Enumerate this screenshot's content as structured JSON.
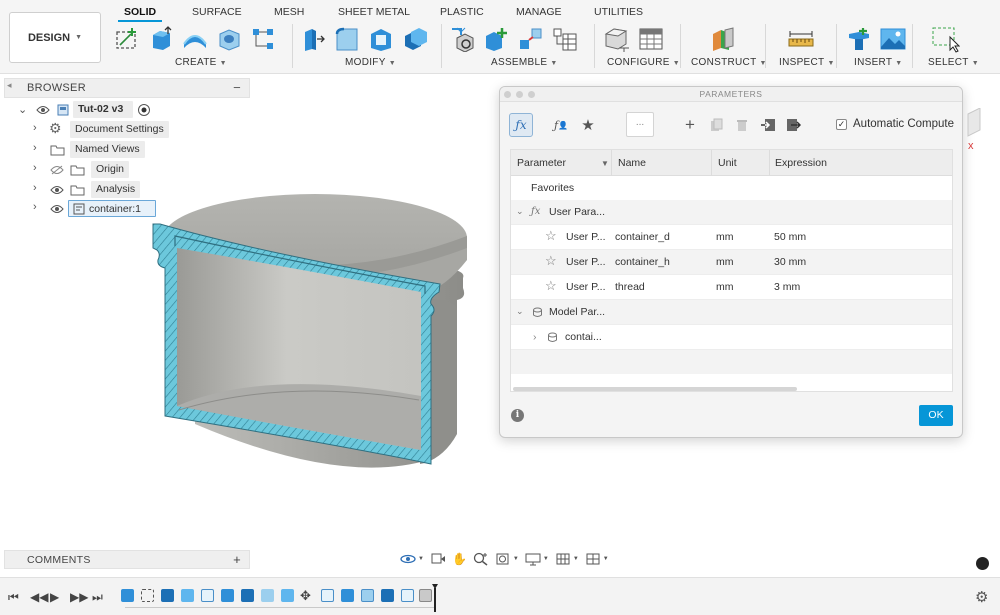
{
  "workspace": {
    "label": "DESIGN"
  },
  "tabs": [
    "SOLID",
    "SURFACE",
    "MESH",
    "SHEET METAL",
    "PLASTIC",
    "MANAGE",
    "UTILITIES"
  ],
  "groups": {
    "create": "CREATE",
    "modify": "MODIFY",
    "assemble": "ASSEMBLE",
    "configure": "CONFIGURE",
    "construct": "CONSTRUCT",
    "inspect": "INSPECT",
    "insert": "INSERT",
    "select": "SELECT"
  },
  "browser": {
    "title": "BROWSER",
    "root": "Tut-02 v3",
    "items": [
      "Document Settings",
      "Named Views",
      "Origin",
      "Analysis",
      "container:1"
    ]
  },
  "comments": {
    "title": "COMMENTS"
  },
  "dialog": {
    "title": "PARAMETERS",
    "filter_value": "...",
    "auto_compute_label": "Automatic Compute",
    "columns": [
      "Parameter",
      "Name",
      "Unit",
      "Expression"
    ],
    "favorites_label": "Favorites",
    "user_group": "User Para...",
    "user_params": [
      {
        "type": "User P...",
        "name": "container_d",
        "unit": "mm",
        "expression": "50 mm"
      },
      {
        "type": "User P...",
        "name": "container_h",
        "unit": "mm",
        "expression": "30 mm"
      },
      {
        "type": "User P...",
        "name": "thread",
        "unit": "mm",
        "expression": "3 mm"
      }
    ],
    "model_group": "Model Par...",
    "model_item": "contai...",
    "ok_label": "OK"
  },
  "colors": {
    "accent": "#0696d7",
    "section_fill": "#5fc3d8",
    "body_gray": "#bcbcb8"
  }
}
